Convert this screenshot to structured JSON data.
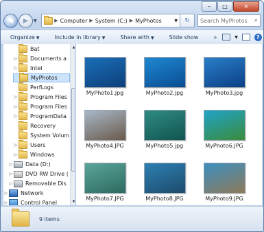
{
  "address": {
    "segments": [
      "Computer",
      "System (C:)",
      "MyPhotos"
    ]
  },
  "search": {
    "placeholder": "Search MyPhotos"
  },
  "toolbar": {
    "organize": "Organize",
    "include_in_library": "Include in library",
    "share_with": "Share with",
    "slide_show": "Slide show"
  },
  "nav_tree": [
    {
      "label": "Bat",
      "icon": "folder"
    },
    {
      "label": "Documents a",
      "icon": "folder"
    },
    {
      "label": "Intel",
      "icon": "folder"
    },
    {
      "label": "MyPhotos",
      "icon": "folder",
      "selected": true
    },
    {
      "label": "PerfLogs",
      "icon": "folder"
    },
    {
      "label": "Program Files",
      "icon": "folder"
    },
    {
      "label": "Program Files",
      "icon": "folder"
    },
    {
      "label": "ProgramData",
      "icon": "folder"
    },
    {
      "label": "Recovery",
      "icon": "folder"
    },
    {
      "label": "System Volum",
      "icon": "folder"
    },
    {
      "label": "Users",
      "icon": "folder"
    },
    {
      "label": "Windows",
      "icon": "folder"
    },
    {
      "label": "Data (D:)",
      "icon": "drive"
    },
    {
      "label": "DVD RW Drive (",
      "icon": "dvd"
    },
    {
      "label": "Removable Dis",
      "icon": "drive"
    },
    {
      "label": "Network",
      "icon": "network"
    },
    {
      "label": "Control Panel",
      "icon": "control-panel"
    }
  ],
  "files": [
    {
      "name": "MyPhoto1.jpg",
      "colors": [
        "#1b6fb8",
        "#0d3f7a"
      ]
    },
    {
      "name": "MyPhoto2.jpg",
      "colors": [
        "#1e88d1",
        "#0a4d93"
      ]
    },
    {
      "name": "MyPhoto3.jpg",
      "colors": [
        "#2a7fc8",
        "#0b3f86"
      ]
    },
    {
      "name": "MyPhoto4.JPG",
      "colors": [
        "#a7b8c9",
        "#6b5a4b"
      ]
    },
    {
      "name": "MyPhoto5.jpg",
      "colors": [
        "#2f8c83",
        "#11544f"
      ]
    },
    {
      "name": "MyPhoto6.JPG",
      "colors": [
        "#1fa3c8",
        "#3c8c3b"
      ]
    },
    {
      "name": "MyPhoto7.JPG",
      "colors": [
        "#5aa59a",
        "#2d6a5f"
      ]
    },
    {
      "name": "MyPhoto8.JPG",
      "colors": [
        "#2d7fb3",
        "#1d4c6c"
      ]
    },
    {
      "name": "MyPhoto9.JPG",
      "colors": [
        "#3b8fbf",
        "#8e7a5a"
      ]
    }
  ],
  "status": {
    "item_count": "9 items"
  }
}
